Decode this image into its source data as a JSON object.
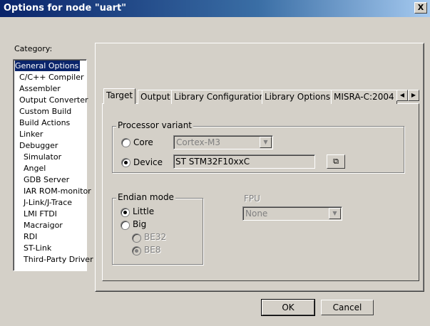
{
  "window": {
    "title": "Options for node \"uart\"",
    "close_glyph": "X"
  },
  "category": {
    "label": "Category:",
    "items": [
      "General Options",
      "C/C++ Compiler",
      "Assembler",
      "Output Converter",
      "Custom Build",
      "Build Actions",
      "Linker",
      "Debugger",
      "Simulator",
      "Angel",
      "GDB Server",
      "IAR ROM-monitor",
      "J-Link/J-Trace",
      "LMI FTDI",
      "Macraigor",
      "RDI",
      "ST-Link",
      "Third-Party Driver"
    ],
    "selected": "General Options"
  },
  "tabs": [
    "Target",
    "Output",
    "Library Configuration",
    "Library Options",
    "MISRA-C:2004"
  ],
  "active_tab": "Target",
  "tab_scroll": {
    "left": "◀",
    "right": "▶"
  },
  "processor_variant": {
    "label": "Processor variant",
    "core_label": "Core",
    "core_value": "Cortex-M3",
    "device_label": "Device",
    "device_value": "ST STM32F10xxC",
    "device_button": "⧉",
    "selected": "Device"
  },
  "endian_mode": {
    "label": "Endian mode",
    "little_label": "Little",
    "big_label": "Big",
    "be32_label": "BE32",
    "be8_label": "BE8",
    "selected": "Little"
  },
  "fpu": {
    "label": "FPU",
    "value": "None"
  },
  "buttons": {
    "ok": "OK",
    "cancel": "Cancel"
  }
}
